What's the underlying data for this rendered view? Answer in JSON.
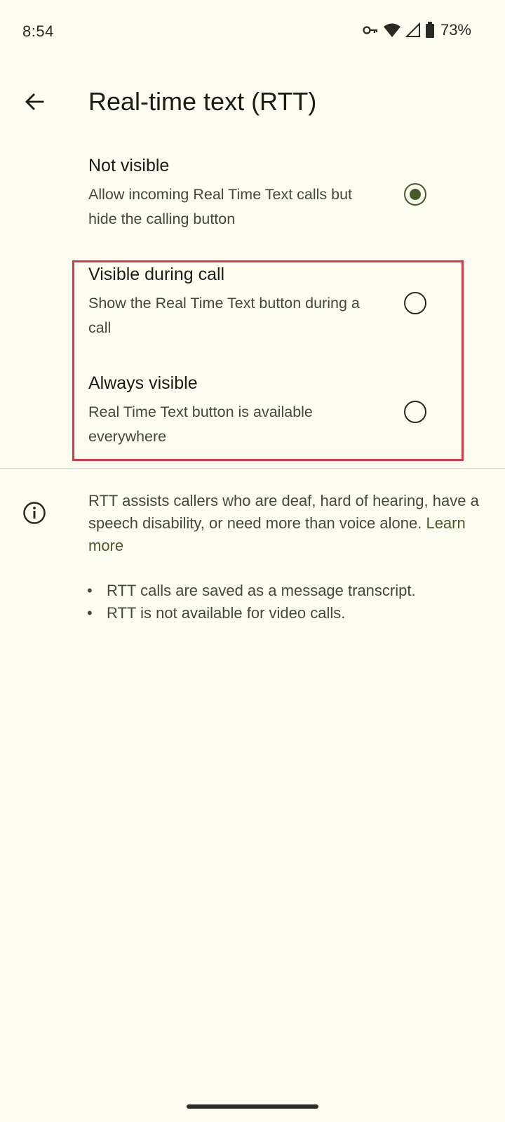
{
  "status_bar": {
    "time": "8:54",
    "battery_percent": "73%",
    "icons": [
      "vpn-key-icon",
      "wifi-icon",
      "cell-signal-icon",
      "battery-icon"
    ]
  },
  "app_bar": {
    "back_icon": "arrow-back-icon",
    "title": "Real-time text (RTT)"
  },
  "options": [
    {
      "title": "Not visible",
      "summary": "Allow incoming Real Time Text calls but hide the calling button",
      "selected": true
    },
    {
      "title": "Visible during call",
      "summary": "Show the Real Time Text button during a call",
      "selected": false
    },
    {
      "title": "Always visible",
      "summary": "Real Time Text button is available everywhere",
      "selected": false
    }
  ],
  "info": {
    "icon": "info-icon",
    "text": "RTT assists callers who are deaf, hard of hearing, have a speech disability, or need more than voice alone.",
    "link": "Learn more",
    "bullets": [
      "RTT calls are saved as a message transcript.",
      "RTT is not available for video calls."
    ]
  },
  "colors": {
    "background": "#fcfcf0",
    "accent": "#4b5a29",
    "highlight_box": "#d93a4a"
  }
}
